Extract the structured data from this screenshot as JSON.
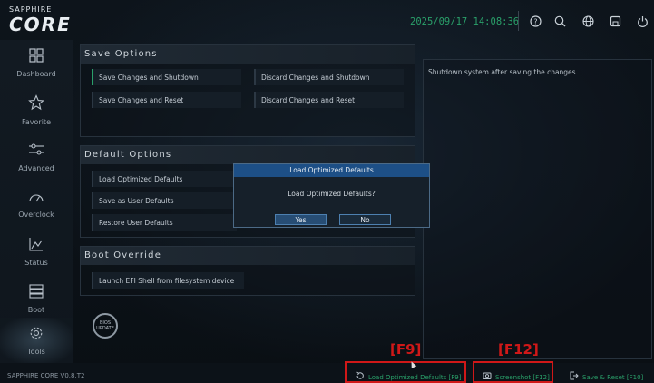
{
  "app": {
    "logo_top": "SAPPHIRE",
    "logo_main": "CORE",
    "datetime": "2025/09/17 14:08:36",
    "version": "SAPPHIRE CORE V0.8.T2"
  },
  "top_icons": [
    "help-icon",
    "search-icon",
    "globe-icon",
    "save-icon",
    "power-icon"
  ],
  "sidebar": {
    "items": [
      {
        "label": "Dashboard",
        "icon": "dashboard-icon"
      },
      {
        "label": "Favorite",
        "icon": "star-icon"
      },
      {
        "label": "Advanced",
        "icon": "sliders-icon"
      },
      {
        "label": "Overclock",
        "icon": "gauge-icon"
      },
      {
        "label": "Status",
        "icon": "chart-icon"
      },
      {
        "label": "Boot",
        "icon": "boot-icon"
      },
      {
        "label": "Tools",
        "icon": "gear-icon"
      }
    ],
    "active": "Tools"
  },
  "save_options": {
    "title": "Save Options",
    "items": [
      "Save Changes and Shutdown",
      "Discard Changes and Shutdown",
      "Save Changes and Reset",
      "Discard Changes and Reset"
    ]
  },
  "default_options": {
    "title": "Default Options",
    "items": [
      "Load Optimized Defaults",
      "Save as User Defaults",
      "Restore User Defaults"
    ]
  },
  "boot_override": {
    "title": "Boot Override",
    "items": [
      "Launch EFI Shell from filesystem device"
    ]
  },
  "help": {
    "text": "Shutdown system after saving the changes."
  },
  "dialog": {
    "title": "Load Optimized Defaults",
    "message": "Load Optimized Defaults?",
    "yes": "Yes",
    "no": "No"
  },
  "bios_update": {
    "line1": "BIOS",
    "line2": "UPDATE"
  },
  "bottom": {
    "load_defaults": "Load Optimized Defaults [F9]",
    "screenshot": "Screenshot [F12]",
    "save_reset": "Save & Reset [F10]"
  },
  "highlights": {
    "f9": "[F9]",
    "f12": "[F12]"
  },
  "colors": {
    "accent": "#2aa06a",
    "highlight": "#d01818",
    "dialog_title": "#1d4f86"
  }
}
